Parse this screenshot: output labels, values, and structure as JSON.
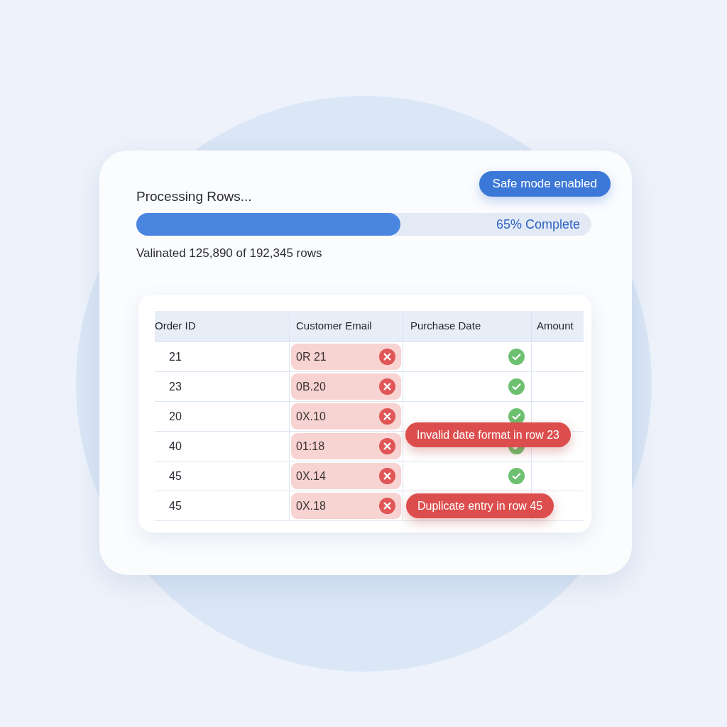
{
  "header": {
    "title": "Processing Rows...",
    "badge": "Safe mode enabled"
  },
  "progress": {
    "level": 0.58,
    "label": "65% Complete",
    "summary": "Valinated 125,890 of 192,345 rows"
  },
  "table": {
    "columns": [
      "Order ID",
      "Customer Email",
      "Purchase Date",
      "Amount"
    ],
    "rows": [
      {
        "order_id": "21",
        "email": {
          "text": "0R 21",
          "valid": false
        },
        "purchase_date": {
          "valid": true
        }
      },
      {
        "order_id": "23",
        "email": {
          "text": "0B.20",
          "valid": false
        },
        "purchase_date": {
          "valid": true
        }
      },
      {
        "order_id": "20",
        "email": {
          "text": "0X.10",
          "valid": false
        },
        "purchase_date": {
          "valid": true
        }
      },
      {
        "order_id": "40",
        "email": {
          "text": "01:18",
          "valid": false
        },
        "purchase_date": {
          "valid": true
        }
      },
      {
        "order_id": "45",
        "email": {
          "text": "0X.14",
          "valid": false
        },
        "purchase_date": {
          "valid": true
        }
      },
      {
        "order_id": "45",
        "email": {
          "text": "0X.18",
          "valid": false
        }
      }
    ]
  },
  "callouts": [
    {
      "text": "Invalid date format in row 23"
    },
    {
      "text": "Duplicate entry in row 45"
    }
  ]
}
